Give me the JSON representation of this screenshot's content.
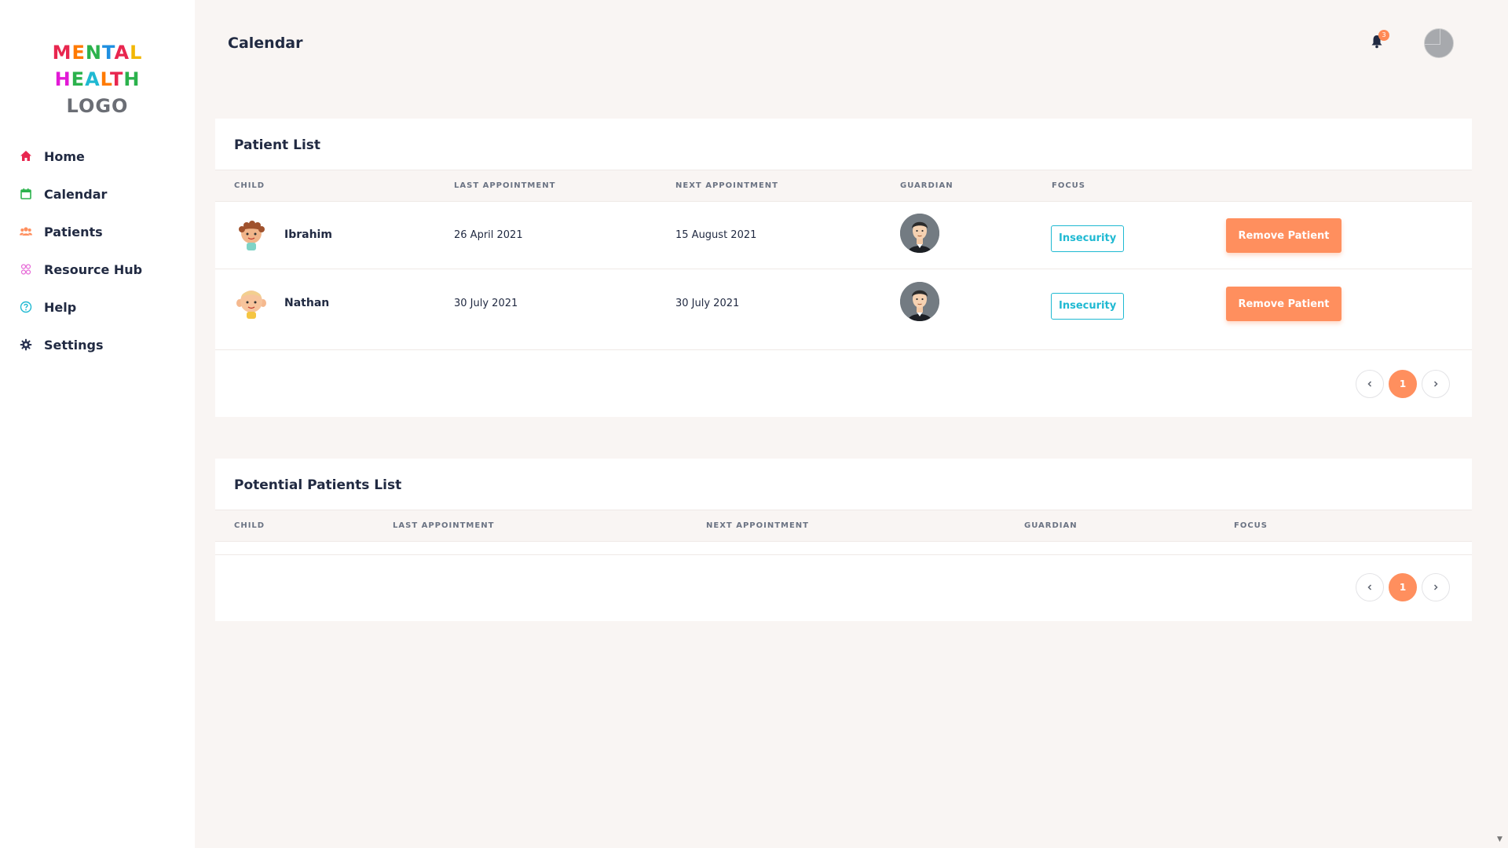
{
  "logo": {
    "line1": "MENTAL",
    "line2": "HEALTH",
    "line3": "LOGO"
  },
  "sidebar": {
    "items": [
      {
        "label": "Home",
        "icon": "home-icon",
        "color": "#e8264f"
      },
      {
        "label": "Calendar",
        "icon": "calendar-icon",
        "color": "#2bb24c"
      },
      {
        "label": "Patients",
        "icon": "users-icon",
        "color": "#ff8f5e"
      },
      {
        "label": "Resource Hub",
        "icon": "resource-hub-icon",
        "color": "#e66ad7"
      },
      {
        "label": "Help",
        "icon": "help-icon",
        "color": "#1fb9d2"
      },
      {
        "label": "Settings",
        "icon": "gear-icon",
        "color": "#2c3554"
      }
    ]
  },
  "header": {
    "title": "Calendar",
    "notification_count": "3"
  },
  "patient_list": {
    "title": "Patient List",
    "columns": [
      "CHILD",
      "LAST APPOINTMENT",
      "NEXT APPOINTMENT",
      "GUARDIAN",
      "FOCUS"
    ],
    "rows": [
      {
        "child": "Ibrahim",
        "last": "26 April 2021",
        "next": "15 August 2021",
        "focus": "Insecurity",
        "action": "Remove Patient"
      },
      {
        "child": "Nathan",
        "last": "30 July 2021",
        "next": "30 July 2021",
        "focus": "Insecurity",
        "action": "Remove Patient"
      }
    ],
    "page": "1"
  },
  "potential_list": {
    "title": "Potential Patients List",
    "columns": [
      "CHILD",
      "LAST APPOINTMENT",
      "NEXT APPOINTMENT",
      "GUARDIAN",
      "FOCUS"
    ],
    "page": "1"
  },
  "colors": {
    "accent": "#ff8f5e",
    "focus": "#1fb9d2",
    "text": "#212a42",
    "background": "#f9f5f3"
  }
}
